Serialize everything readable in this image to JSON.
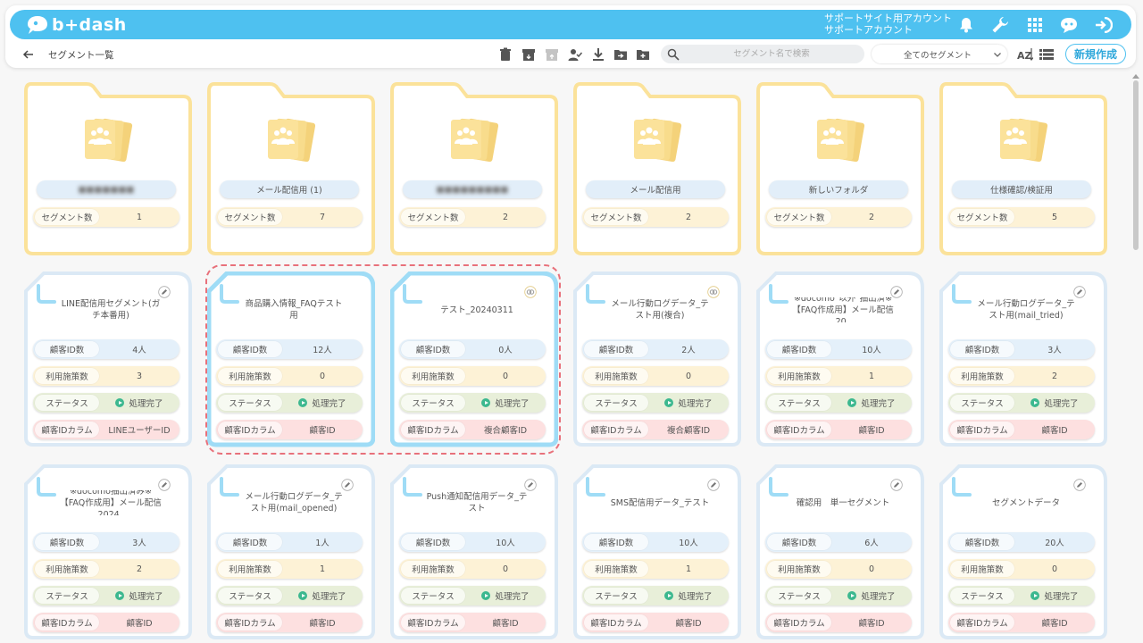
{
  "header": {
    "logo": "b+dash",
    "account_line1": "サポートサイト用アカウント",
    "account_line2": "サポートアカウント"
  },
  "toolbar": {
    "breadcrumb": "セグメント一覧",
    "search_placeholder": "セグメント名で検索",
    "filter_value": "全てのセグメント",
    "new_button": "新規作成"
  },
  "labels": {
    "segment_count": "セグメント数",
    "customer_id_count": "顧客ID数",
    "used_measures": "利用施策数",
    "status": "ステータス",
    "customer_id_column": "顧客IDカラム"
  },
  "colors": {
    "accent": "#4ec1f0",
    "folder": "#fbe29a",
    "segment_border": "#dbe9f5",
    "selected_border": "#9fdcf6",
    "selection_outline": "#e8717b"
  },
  "folders": [
    {
      "name": "■■■■■■■",
      "count": "1",
      "blurred": true
    },
    {
      "name": "メール配信用 (1)",
      "count": "7",
      "blurred": false
    },
    {
      "name": "■■■■■■■■■",
      "count": "2",
      "blurred": true
    },
    {
      "name": "メール配信用",
      "count": "2",
      "blurred": false
    },
    {
      "name": "新しいフォルダ",
      "count": "2",
      "blurred": false
    },
    {
      "name": "仕様確認/検証用",
      "count": "5",
      "blurred": false
    }
  ],
  "segments_row1": [
    {
      "title": "LINE配信用セグメント(ガチ本番用)",
      "ids": "4人",
      "measures": "3",
      "status": "処理完了",
      "column": "LINEユーザーID",
      "icon": "compose"
    },
    {
      "title": "商品購入情報_FAQテスト用",
      "ids": "12人",
      "measures": "0",
      "status": "処理完了",
      "column": "顧客ID",
      "icon": "none",
      "selected": true
    },
    {
      "title": "テスト_20240311",
      "ids": "0人",
      "measures": "0",
      "status": "処理完了",
      "column": "複合顧客ID",
      "icon": "link",
      "selected": true
    },
    {
      "title": "メール行動ログデータ_テスト用(複合)",
      "ids": "2人",
      "measures": "0",
      "status": "処理完了",
      "column": "複合顧客ID",
      "icon": "link"
    },
    {
      "title": "※docomo\"以外\"抽出済※【FAQ作成用】メール配信_20…",
      "ids": "10人",
      "measures": "1",
      "status": "処理完了",
      "column": "顧客ID",
      "icon": "compose"
    },
    {
      "title": "メール行動ログデータ_テスト用(mail_tried)",
      "ids": "3人",
      "measures": "2",
      "status": "処理完了",
      "column": "顧客ID",
      "icon": "compose"
    }
  ],
  "segments_row2": [
    {
      "title": "※docomo抽出済み※【FAQ作成用】メール配信_2024…",
      "ids": "3人",
      "measures": "2",
      "status": "処理完了",
      "column": "顧客ID",
      "icon": "compose"
    },
    {
      "title": "メール行動ログデータ_テスト用(mail_opened)",
      "ids": "1人",
      "measures": "1",
      "status": "処理完了",
      "column": "顧客ID",
      "icon": "compose"
    },
    {
      "title": "Push通知配信用データ_テスト",
      "ids": "10人",
      "measures": "0",
      "status": "処理完了",
      "column": "顧客ID",
      "icon": "compose"
    },
    {
      "title": "SMS配信用データ_テスト",
      "ids": "10人",
      "measures": "1",
      "status": "処理完了",
      "column": "顧客ID",
      "icon": "compose"
    },
    {
      "title": "確認用　単一セグメント",
      "ids": "6人",
      "measures": "0",
      "status": "処理完了",
      "column": "顧客ID",
      "icon": "compose"
    },
    {
      "title": "セグメントデータ",
      "ids": "20人",
      "measures": "0",
      "status": "処理完了",
      "column": "顧客ID",
      "icon": "compose"
    }
  ]
}
